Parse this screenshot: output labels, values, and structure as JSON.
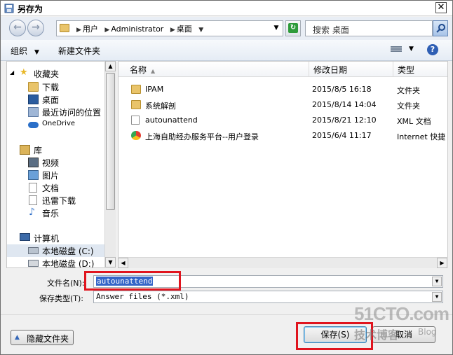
{
  "window": {
    "title": "另存为",
    "close_glyph": "✕"
  },
  "address": {
    "crumbs": [
      "用户",
      "Administrator",
      "桌面"
    ],
    "search_placeholder": "搜索 桌面"
  },
  "toolbar": {
    "organize": "组织",
    "new_folder": "新建文件夹",
    "help": "?"
  },
  "nav": {
    "favorites": "收藏夹",
    "favorites_items": [
      "下载",
      "桌面",
      "最近访问的位置",
      "OneDrive"
    ],
    "libraries": "库",
    "libraries_items": [
      "视频",
      "图片",
      "文档",
      "迅雷下载",
      "音乐"
    ],
    "computer": "计算机",
    "computer_items": [
      "本地磁盘 (C:)",
      "本地磁盘 (D:)"
    ]
  },
  "files": {
    "columns": [
      "名称",
      "修改日期",
      "类型"
    ],
    "rows": [
      {
        "name": "IPAM",
        "date": "2015/8/5 16:18",
        "type": "文件夹",
        "icon": "folder-icon"
      },
      {
        "name": "系统解剖",
        "date": "2015/8/14 14:04",
        "type": "文件夹",
        "icon": "folder-icon"
      },
      {
        "name": "autounattend",
        "date": "2015/8/21 12:10",
        "type": "XML 文档",
        "icon": "xml-file-icon"
      },
      {
        "name": "上海自助经办服务平台--用户登录",
        "date": "2015/6/4 11:17",
        "type": "Internet 快捷",
        "icon": "internet-shortcut-icon"
      }
    ]
  },
  "form": {
    "filename_label": "文件名(N):",
    "filename_value": "autounattend",
    "filetype_label": "保存类型(T):",
    "filetype_value": "Answer files (*.xml)"
  },
  "buttons": {
    "hide_folders": "隐藏文件夹",
    "save": "保存(S)",
    "cancel": "取消"
  },
  "watermark": {
    "brand": "51CTO.com",
    "tagline": "技术博客",
    "blog": "Blog"
  }
}
